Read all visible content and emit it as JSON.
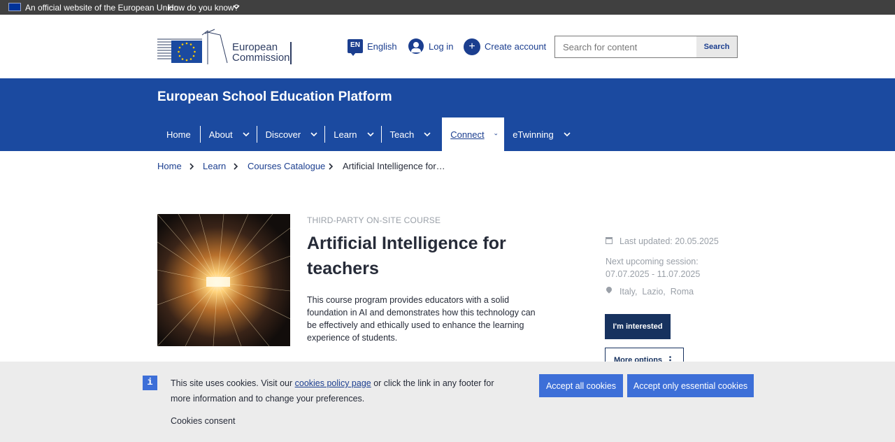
{
  "eu_bar": {
    "official_text": "An official website of the European Union",
    "how_text": "How do you know?"
  },
  "header": {
    "logo_line1": "European",
    "logo_line2": "Commission",
    "language_code": "EN",
    "language_label": "English",
    "login_label": "Log in",
    "create_account_label": "Create account",
    "search_placeholder": "Search for content",
    "search_button": "Search"
  },
  "site_title": "European School Education Platform",
  "nav": {
    "items": [
      {
        "label": "Home",
        "has_dropdown": false,
        "active": false
      },
      {
        "label": "About",
        "has_dropdown": true,
        "active": false
      },
      {
        "label": "Discover",
        "has_dropdown": true,
        "active": false
      },
      {
        "label": "Learn",
        "has_dropdown": true,
        "active": false
      },
      {
        "label": "Teach",
        "has_dropdown": true,
        "active": false
      },
      {
        "label": "Connect",
        "has_dropdown": true,
        "active": true
      },
      {
        "label": "eTwinning",
        "has_dropdown": true,
        "active": false
      }
    ]
  },
  "breadcrumb": [
    "Home",
    "Learn",
    "Courses Catalogue",
    "Artificial Intelligence for…"
  ],
  "course": {
    "eyebrow": "THIRD-PARTY ON-SITE COURSE",
    "title": "Artificial Intelligence for teachers",
    "description": "This course program provides educators with a solid foundation in AI and demonstrates how this technology can be effectively and ethically used to enhance the learning experience of students."
  },
  "meta": {
    "last_updated": "Last updated: 20.05.2025",
    "next_session_label": "Next upcoming session:",
    "next_session_dates": "07.07.2025 - 11.07.2025",
    "location": "Italy,  Lazio,  Roma"
  },
  "actions": {
    "interested": "I'm interested",
    "more_options": "More options"
  },
  "cookie": {
    "info_glyph": "i",
    "text_before": "This site uses cookies. Visit our ",
    "link": "cookies policy page",
    "text_after": " or click the link in any footer for more information and to change your preferences.",
    "consent_label": "Cookies consent",
    "accept_all": "Accept all cookies",
    "accept_essential": "Accept only essential cookies"
  },
  "colors": {
    "brand_blue": "#1b4aa0",
    "link_blue": "#1b3e8f",
    "button_dark": "#17325f",
    "cookie_button": "#3d6fd8"
  }
}
